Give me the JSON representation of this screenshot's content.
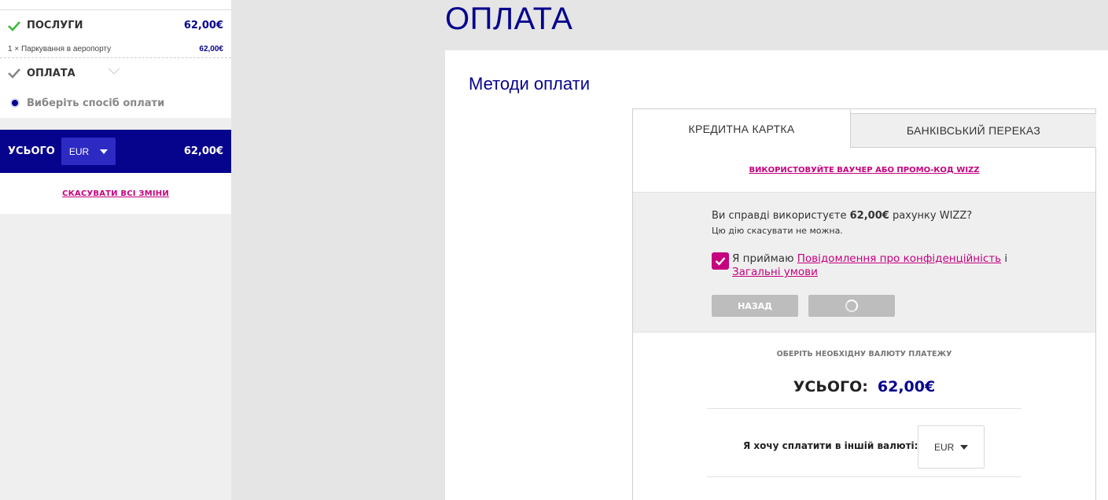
{
  "sidebar": {
    "services": {
      "title": "ПОСЛУГИ",
      "amount": "62,00€"
    },
    "services_item": {
      "label": "1 × Паркування в аеропорту",
      "amount": "62,00€"
    },
    "payment": {
      "title": "ОПЛАТА"
    },
    "choose_method": {
      "label": "Виберіть спосіб оплати"
    },
    "total": {
      "label": "УСЬОГО",
      "currency": "EUR",
      "amount": "62,00€"
    },
    "cancel_link": "СКАСУВАТИ ВСІ ЗМІНИ"
  },
  "main": {
    "page_title": "ОПЛАТА",
    "methods_title": "Методи оплати",
    "tabs": [
      {
        "label": "КРЕДИТНА КАРТКА",
        "active": true
      },
      {
        "label": "БАНКІВСЬКИЙ ПЕРЕКАЗ",
        "active": false
      }
    ],
    "voucher_link": "ВИКОРИСТОВУЙТЕ ВАУЧЕР АБО ПРОМО-КОД WIZZ",
    "confirm": {
      "question_prefix": "Ви справді використуєте ",
      "question_amount": "62,00€",
      "question_suffix": " рахунку WIZZ?",
      "note": "Цю дію скасувати не можна.",
      "accept_prefix": "Я приймаю ",
      "privacy_link": "Повідомлення про конфіденційність",
      "accept_mid": " і ",
      "terms_link": "Загальні умови",
      "back_button": "НАЗАД"
    },
    "currency": {
      "choose_label": "ОБЕРІТЬ НЕОБХІДНУ ВАЛЮТУ ПЛАТЕЖУ",
      "total_label": "УСЬОГО:",
      "total_value": "62,00€",
      "pay_other_label": "Я хочу сплатити в іншій валюті:",
      "selected": "EUR"
    }
  },
  "colors": {
    "brand_blue": "#06038d",
    "accent_magenta": "#c6007e",
    "success_green": "#3dba3d"
  }
}
